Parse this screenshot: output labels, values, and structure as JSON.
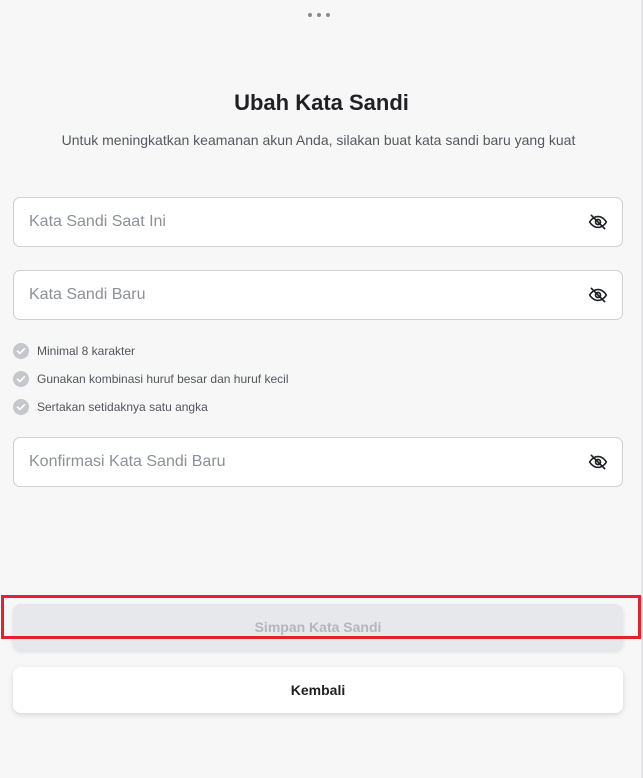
{
  "header": {
    "menu_icon": "more-dots-icon"
  },
  "page": {
    "title": "Ubah Kata Sandi",
    "subtitle": "Untuk meningkatkan keamanan akun Anda, silakan buat kata sandi baru yang kuat"
  },
  "form": {
    "current_password": {
      "placeholder": "Kata Sandi Saat Ini",
      "value": "",
      "icon": "eye-off-icon"
    },
    "new_password": {
      "placeholder": "Kata Sandi Baru",
      "value": "",
      "icon": "eye-off-icon"
    },
    "confirm_password": {
      "placeholder": "Konfirmasi Kata Sandi Baru",
      "value": "",
      "icon": "eye-off-icon"
    }
  },
  "requirements": [
    {
      "text": "Minimal 8 karakter",
      "icon": "check-circle-icon"
    },
    {
      "text": "Gunakan kombinasi huruf besar dan huruf kecil",
      "icon": "check-circle-icon"
    },
    {
      "text": "Sertakan setidaknya satu angka",
      "icon": "check-circle-icon"
    }
  ],
  "actions": {
    "save_label": "Simpan Kata Sandi",
    "back_label": "Kembali"
  },
  "colors": {
    "background": "#f7f7f8",
    "disabled_button": "#e7e8eb",
    "highlight_border": "#e3222c",
    "check_icon": "#c5c7cc"
  }
}
